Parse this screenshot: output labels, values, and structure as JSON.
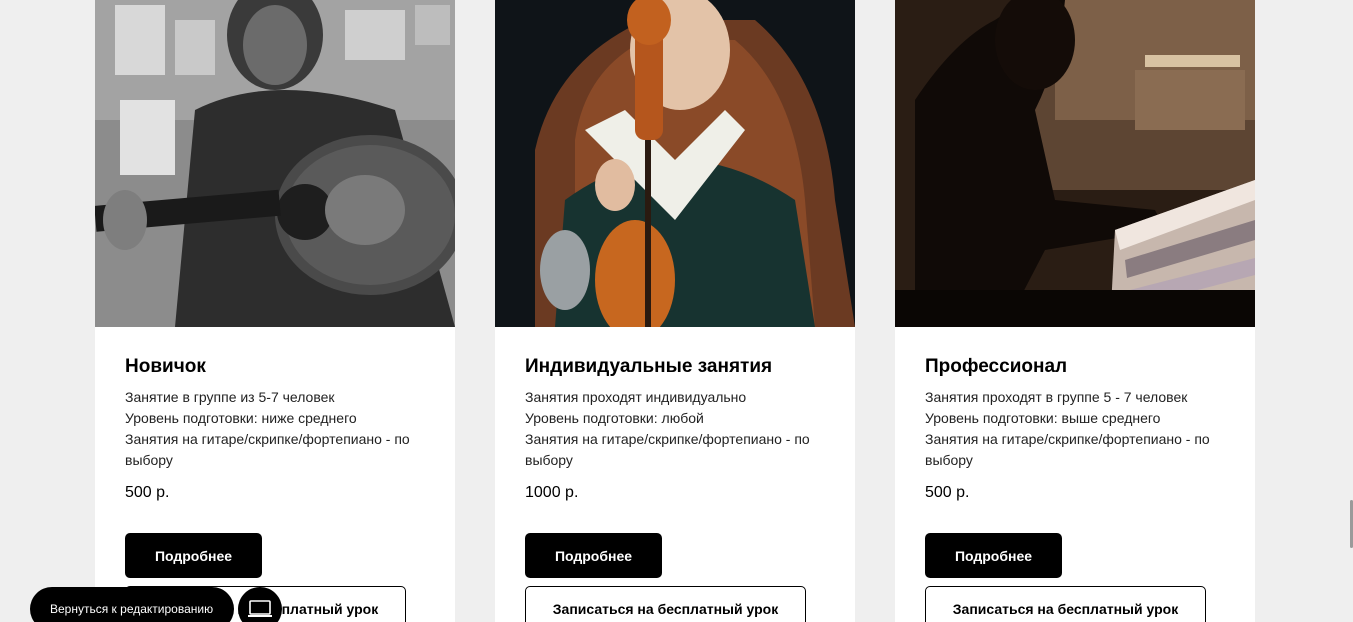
{
  "cards": [
    {
      "title": "Новичок",
      "lines": [
        "Занятие в группе из 5-7 человек",
        "Уровень подготовки: ниже среднего",
        "Занятия на гитаре/скрипке/фортепиано - по",
        "выбору"
      ],
      "price": "500 р.",
      "details_label": "Подробнее",
      "signup_label": "Записаться на бесплатный урок",
      "image_icon": "child-with-guitar-photo"
    },
    {
      "title": "Индивидуальные занятия",
      "lines": [
        "Занятия проходят индивидуально",
        "Уровень подготовки: любой",
        "Занятия на гитаре/скрипке/фортепиано - по",
        "выбору"
      ],
      "price": "1000 р.",
      "details_label": "Подробнее",
      "signup_label": "Записаться на бесплатный урок",
      "image_icon": "girl-with-violin-photo"
    },
    {
      "title": "Профессионал",
      "lines": [
        "Занятия проходят в группе 5 - 7 человек",
        "Уровень подготовки: выше среднего",
        "Занятия на гитаре/скрипке/фортепиано - по",
        "выбору"
      ],
      "price": "500 р.",
      "details_label": "Подробнее",
      "signup_label": "Записаться на бесплатный урок",
      "image_icon": "child-at-piano-photo"
    }
  ],
  "editor": {
    "back_label": "Вернуться к редактированию",
    "device_icon": "laptop-icon"
  }
}
